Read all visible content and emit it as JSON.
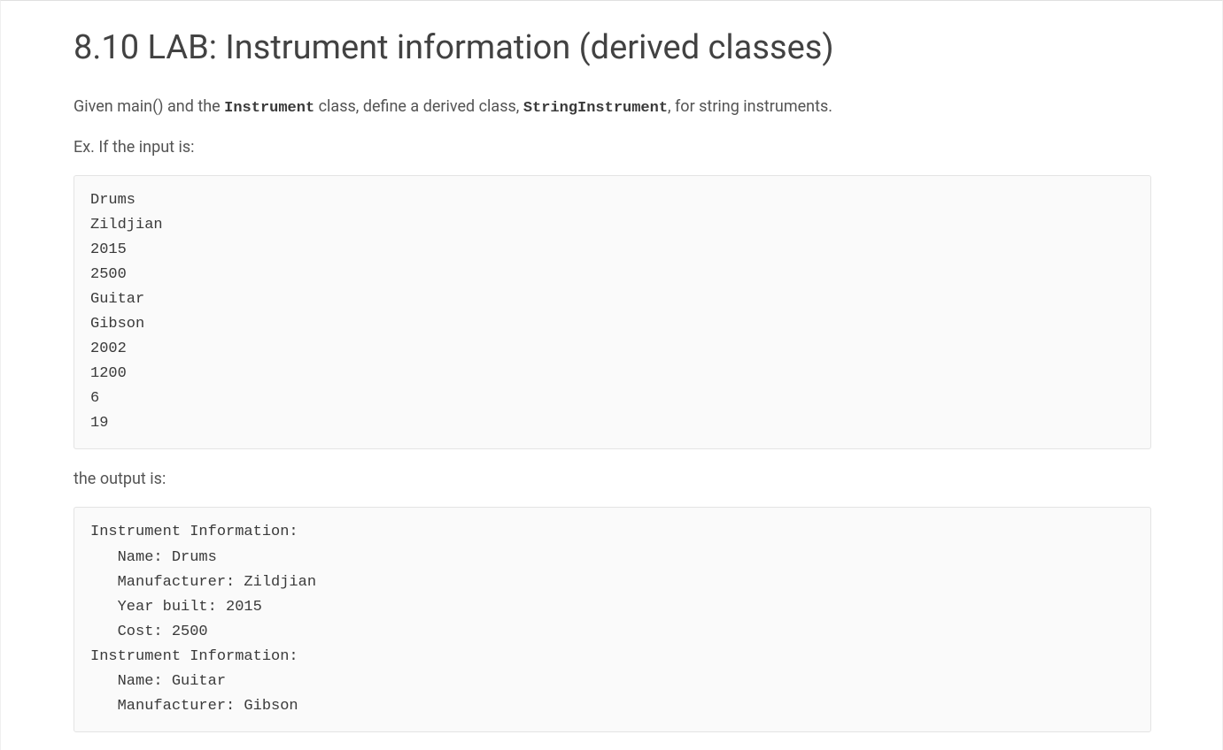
{
  "title": "8.10 LAB: Instrument information (derived classes)",
  "intro": {
    "pre": "Given main() and the ",
    "code1": "Instrument",
    "mid": " class, define a derived class, ",
    "code2": "StringInstrument",
    "post": ", for string instruments."
  },
  "example_label": "Ex. If the input is:",
  "input_block": "Drums\nZildjian\n2015\n2500\nGuitar\nGibson\n2002\n1200\n6\n19",
  "output_label": "the output is:",
  "output_block": "Instrument Information:\n   Name: Drums\n   Manufacturer: Zildjian\n   Year built: 2015\n   Cost: 2500\nInstrument Information:\n   Name: Guitar\n   Manufacturer: Gibson"
}
